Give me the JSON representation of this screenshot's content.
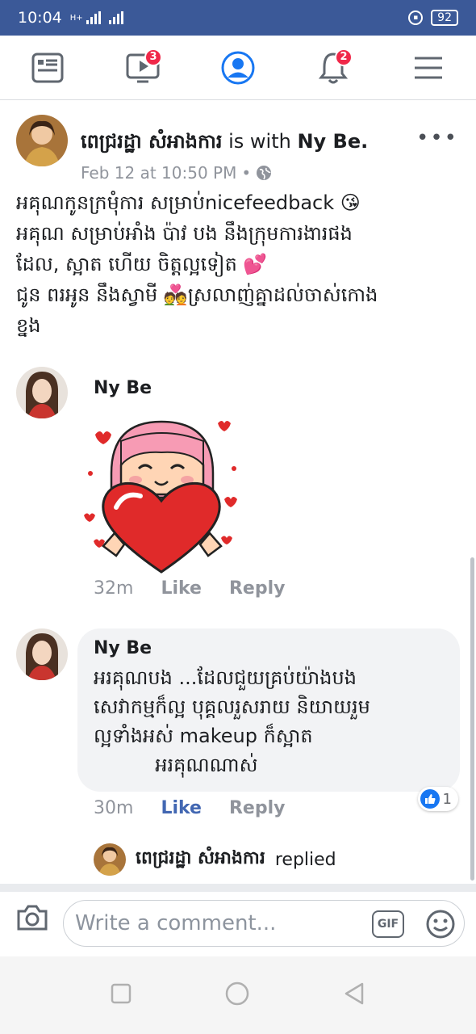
{
  "status_bar": {
    "time": "10:04",
    "net_label": "H+",
    "battery": "92"
  },
  "nav": {
    "video_badge": "3",
    "notifications_badge": "2"
  },
  "post": {
    "author": "ពេជ្ររដ្ឋា សំអាងការ",
    "with_text": " is with ",
    "tagged": "Ny Be.",
    "timestamp": "Feb 12 at 10:50 PM",
    "separator": "•",
    "body_lines": [
      "អគុណកូនក្រមុំការ សម្រាប់nicefeedback 😘",
      "អគុណ សម្រាប់អាំង ប៉ាវ បង នឹងក្រុមការងារផង",
      "ដែល, ស្អាត ហើយ ចិត្តល្អទៀត 💕",
      "ជូន ពរអូន នឹងស្វាមី 💑ស្រលាញ់គ្នាដល់ចាស់កោង",
      "ខ្នង"
    ]
  },
  "comments": [
    {
      "name": "Ny Be",
      "time": "32m",
      "like": "Like",
      "reply": "Reply"
    },
    {
      "name": "Ny Be",
      "lines": [
        "អរគុណបង ...ដែលជួយគ្រប់យ៉ាងបង",
        "សេវាកម្មក៏ល្អ បុគ្គលរួសរាយ និយាយរួម",
        "ល្អទាំងអស់ makeup ក៏ស្អាត",
        "          អរគុណណាស់"
      ],
      "time": "30m",
      "like": "Like",
      "reply": "Reply",
      "reaction_count": "1"
    }
  ],
  "reply_note": {
    "author": "ពេជ្ររដ្ឋា សំអាងការ",
    "text": "replied"
  },
  "composer": {
    "placeholder": "Write a comment...",
    "gif_label": "GIF"
  },
  "colors": {
    "brand": "#3b5998",
    "like_blue": "#4267b2",
    "badge": "#f02849"
  }
}
